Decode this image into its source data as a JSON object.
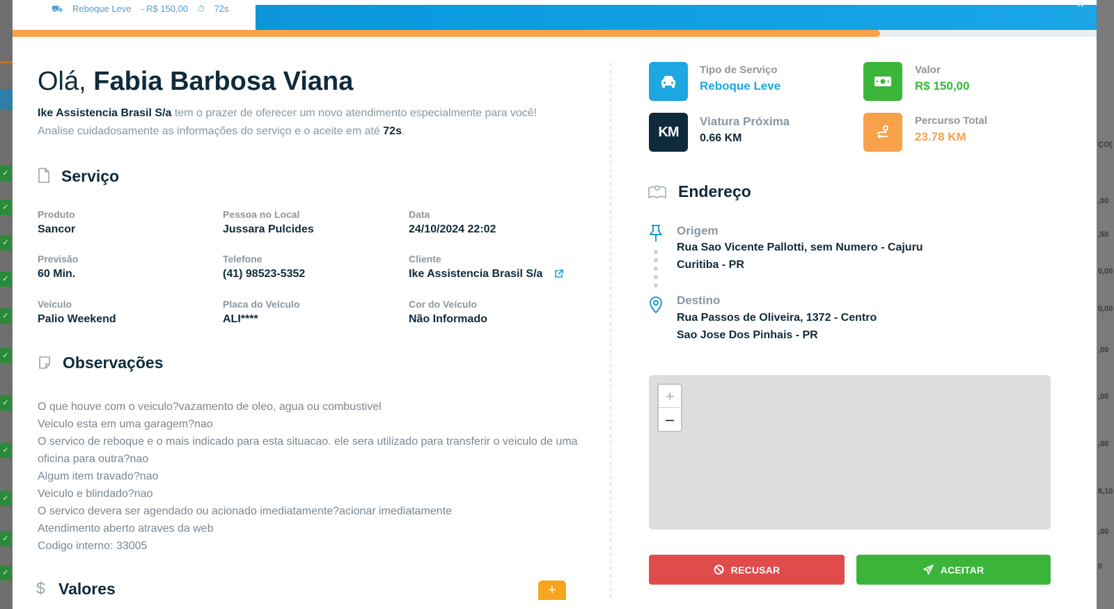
{
  "top_bar": {
    "service_text": "Reboque Leve",
    "price_text": "- R$ 150,00",
    "timer_text": "72s",
    "progress_percent": 80
  },
  "greeting": {
    "prefix": "Olá,",
    "name": "Fabia Barbosa Viana"
  },
  "intro": {
    "company": "Ike Assistencia Brasil S/a",
    "text1": "tem o prazer de oferecer um novo atendimento especialmente para você!",
    "text2": "Analise cuidadosamente as informações do serviço e o aceite em até",
    "timer": "72s",
    "end": "."
  },
  "service": {
    "title": "Serviço",
    "fields": [
      {
        "label": "Produto",
        "value": "Sancor"
      },
      {
        "label": "Pessoa no Local",
        "value": "Jussara Pulcides"
      },
      {
        "label": "Data",
        "value": "24/10/2024 22:02"
      },
      {
        "label": "Previsão",
        "value": "60 Min."
      },
      {
        "label": "Telefone",
        "value": "(41) 98523-5352"
      },
      {
        "label": "Cliente",
        "value": "Ike Assistencia Brasil S/a"
      },
      {
        "label": "Veículo",
        "value": "Palio Weekend"
      },
      {
        "label": "Placa do Veículo",
        "value": "ALI****"
      },
      {
        "label": "Cor do Veículo",
        "value": "Não Informado"
      }
    ]
  },
  "observations": {
    "title": "Observações",
    "lines": [
      "O que houve com o veiculo?vazamento de oleo, agua ou combustivel",
      "Veiculo esta em uma garagem?nao",
      "O servico de reboque e o mais indicado para esta situacao. ele sera utilizado para transferir o veiculo de uma oficina para outra?nao",
      "Algum item travado?nao",
      "Veiculo e blindado?nao",
      "O servico devera ser agendado ou acionado imediatamente?acionar imediatamente",
      "Atendimento aberto atraves da web",
      "Codigo interno: 33005"
    ]
  },
  "values_section": {
    "title": "Valores",
    "add_label": "+"
  },
  "stats": {
    "service_type": {
      "label": "Tipo de Serviço",
      "value": "Reboque Leve",
      "color": "#1ea7e0"
    },
    "price": {
      "label": "Valor",
      "value": "R$ 150,00",
      "color": "#3ab53a"
    },
    "nearby": {
      "label": "Viatura Próxima",
      "value": "0.66 KM",
      "icon_text": "KM",
      "color": "#0f2a3a"
    },
    "total": {
      "label": "Percurso Total",
      "value": "23.78 KM",
      "color": "#f7a24a"
    }
  },
  "address": {
    "title": "Endereço",
    "origin_label": "Origem",
    "origin_line1": "Rua Sao Vicente Pallotti, sem Numero - Cajuru",
    "origin_line2": "Curitiba - PR",
    "dest_label": "Destino",
    "dest_line1": "Rua Passos de Oliveira, 1372 - Centro",
    "dest_line2": "Sao Jose Dos Pinhais - PR"
  },
  "map": {
    "zoom_in": "+",
    "zoom_out": "–"
  },
  "actions": {
    "refuse": "RECUSAR",
    "accept": "ACEITAR"
  },
  "background": {
    "right_values": [
      ",00",
      ",50",
      "0,00",
      "0,00",
      ",00",
      ",00",
      ",00",
      "8,10",
      ",00",
      "0"
    ],
    "right_header": "ÇO("
  }
}
